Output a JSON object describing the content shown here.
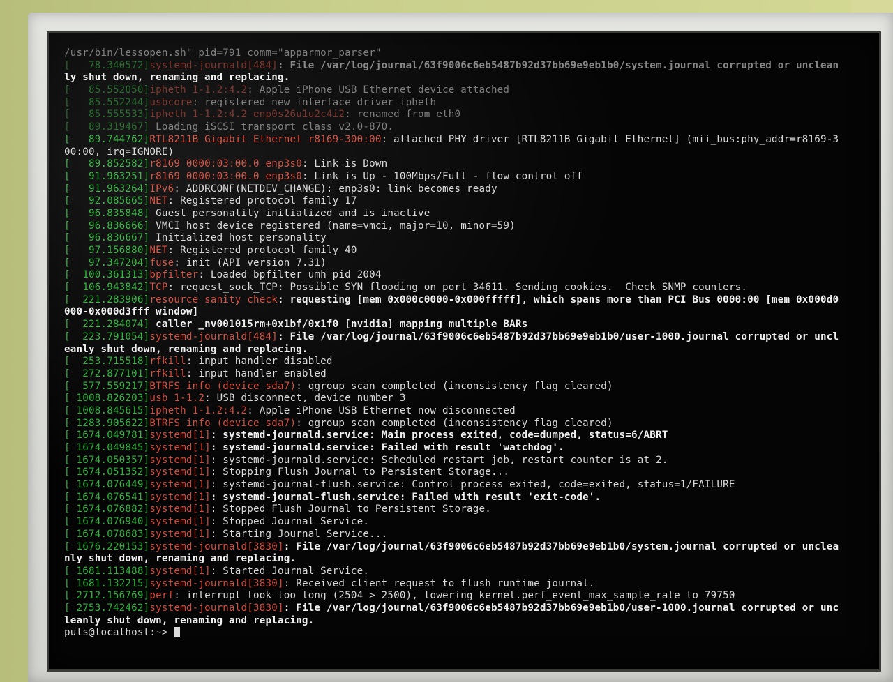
{
  "terminal": {
    "lines": [
      {
        "br": "",
        "ts": "",
        "src": "",
        "msg": "/usr/bin/lessopen.sh\" pid=791 comm=\"apparmor_parser\"",
        "dim": true
      },
      {
        "br": "[",
        "ts": "   78.340572]",
        "src": "systemd-journald[484]",
        "msg": ": File /var/log/journal/63f9006c6eb5487b92d37bb69e9eb1b0/system.journal corrupted or unclean",
        "bold": true,
        "dim": true
      },
      {
        "br": "",
        "ts": "",
        "src": "",
        "msg": "ly shut down, renaming and replacing.",
        "bold": true
      },
      {
        "br": "[",
        "ts": "   85.552050]",
        "src": "ipheth 1-1.2:4.2",
        "msg": ": Apple iPhone USB Ethernet device attached",
        "dim": true
      },
      {
        "br": "[",
        "ts": "   85.552244]",
        "src": "usbcore",
        "msg": ": registered new interface driver ipheth",
        "dim": true
      },
      {
        "br": "[",
        "ts": "   85.555533]",
        "src": "ipheth 1-1.2:4.2 enp0s26u1u2c4i2",
        "msg": ": renamed from eth0",
        "dim": true
      },
      {
        "br": "[",
        "ts": "   89.319467]",
        "src": "",
        "msg": " Loading iSCSI transport class v2.0-870.",
        "dim": true
      },
      {
        "br": "[",
        "ts": "   89.744762]",
        "src": "RTL8211B Gigabit Ethernet r8169-300:00",
        "msg": ": attached PHY driver [RTL8211B Gigabit Ethernet] (mii_bus:phy_addr=r8169-3"
      },
      {
        "br": "",
        "ts": "",
        "src": "",
        "msg": "00:00, irq=IGNORE)"
      },
      {
        "br": "[",
        "ts": "   89.852582]",
        "src": "r8169 0000:03:00.0 enp3s0",
        "msg": ": Link is Down"
      },
      {
        "br": "[",
        "ts": "   91.963251]",
        "src": "r8169 0000:03:00.0 enp3s0",
        "msg": ": Link is Up - 100Mbps/Full - flow control off"
      },
      {
        "br": "[",
        "ts": "   91.963264]",
        "src": "IPv6",
        "msg": ": ADDRCONF(NETDEV_CHANGE): enp3s0: link becomes ready"
      },
      {
        "br": "[",
        "ts": "   92.085665]",
        "src": "NET",
        "msg": ": Registered protocol family 17"
      },
      {
        "br": "[",
        "ts": "   96.835848]",
        "src": "",
        "msg": " Guest personality initialized and is inactive"
      },
      {
        "br": "[",
        "ts": "   96.836666]",
        "src": "",
        "msg": " VMCI host device registered (name=vmci, major=10, minor=59)"
      },
      {
        "br": "[",
        "ts": "   96.836667]",
        "src": "",
        "msg": " Initialized host personality"
      },
      {
        "br": "[",
        "ts": "   97.156880]",
        "src": "NET",
        "msg": ": Registered protocol family 40"
      },
      {
        "br": "[",
        "ts": "   97.347204]",
        "src": "fuse",
        "msg": ": init (API version 7.31)"
      },
      {
        "br": "[",
        "ts": "  100.361313]",
        "src": "bpfilter",
        "msg": ": Loaded bpfilter_umh pid 2004"
      },
      {
        "br": "[",
        "ts": "  106.943842]",
        "src": "TCP",
        "msg": ": request_sock_TCP: Possible SYN flooding on port 34611. Sending cookies.  Check SNMP counters."
      },
      {
        "br": "[",
        "ts": "  221.283906]",
        "src": "resource sanity check",
        "msg": ": requesting [mem 0x000c0000-0x000fffff], which spans more than PCI Bus 0000:00 [mem 0x000d0",
        "bold": true
      },
      {
        "br": "",
        "ts": "",
        "src": "",
        "msg": "000-0x000d3fff window]",
        "bold": true
      },
      {
        "br": "[",
        "ts": "  221.284074]",
        "src": "",
        "msg": " caller _nv001015rm+0x1bf/0x1f0 [nvidia] mapping multiple BARs",
        "bold": true
      },
      {
        "br": "[",
        "ts": "  223.791054]",
        "src": "systemd-journald[484]",
        "msg": ": File /var/log/journal/63f9006c6eb5487b92d37bb69e9eb1b0/user-1000.journal corrupted or uncl",
        "bold": true
      },
      {
        "br": "",
        "ts": "",
        "src": "",
        "msg": "eanly shut down, renaming and replacing.",
        "bold": true
      },
      {
        "br": "[",
        "ts": "  253.715518]",
        "src": "rfkill",
        "msg": ": input handler disabled"
      },
      {
        "br": "[",
        "ts": "  272.877101]",
        "src": "rfkill",
        "msg": ": input handler enabled"
      },
      {
        "br": "[",
        "ts": "  577.559217]",
        "src": "BTRFS info (device sda7)",
        "msg": ": qgroup scan completed (inconsistency flag cleared)"
      },
      {
        "br": "[",
        "ts": " 1008.826203]",
        "src": "usb 1-1.2",
        "msg": ": USB disconnect, device number 3"
      },
      {
        "br": "[",
        "ts": " 1008.845615]",
        "src": "ipheth 1-1.2:4.2",
        "msg": ": Apple iPhone USB Ethernet now disconnected"
      },
      {
        "br": "[",
        "ts": " 1283.905622]",
        "src": "BTRFS info (device sda7)",
        "msg": ": qgroup scan completed (inconsistency flag cleared)"
      },
      {
        "br": "[",
        "ts": " 1674.049781]",
        "src": "systemd[1]",
        "msg": ": systemd-journald.service: Main process exited, code=dumped, status=6/ABRT",
        "bold": true
      },
      {
        "br": "[",
        "ts": " 1674.049845]",
        "src": "systemd[1]",
        "msg": ": systemd-journald.service: Failed with result 'watchdog'.",
        "bold": true
      },
      {
        "br": "[",
        "ts": " 1674.050357]",
        "src": "systemd[1]",
        "msg": ": systemd-journald.service: Scheduled restart job, restart counter is at 2."
      },
      {
        "br": "[",
        "ts": " 1674.051352]",
        "src": "systemd[1]",
        "msg": ": Stopping Flush Journal to Persistent Storage..."
      },
      {
        "br": "[",
        "ts": " 1674.076449]",
        "src": "systemd[1]",
        "msg": ": systemd-journal-flush.service: Control process exited, code=exited, status=1/FAILURE"
      },
      {
        "br": "[",
        "ts": " 1674.076541]",
        "src": "systemd[1]",
        "msg": ": systemd-journal-flush.service: Failed with result 'exit-code'.",
        "bold": true
      },
      {
        "br": "[",
        "ts": " 1674.076882]",
        "src": "systemd[1]",
        "msg": ": Stopped Flush Journal to Persistent Storage."
      },
      {
        "br": "[",
        "ts": " 1674.076940]",
        "src": "systemd[1]",
        "msg": ": Stopped Journal Service."
      },
      {
        "br": "[",
        "ts": " 1674.078683]",
        "src": "systemd[1]",
        "msg": ": Starting Journal Service..."
      },
      {
        "br": "[",
        "ts": " 1676.220153]",
        "src": "systemd-journald[3830]",
        "msg": ": File /var/log/journal/63f9006c6eb5487b92d37bb69e9eb1b0/system.journal corrupted or unclea",
        "bold": true
      },
      {
        "br": "",
        "ts": "",
        "src": "",
        "msg": "nly shut down, renaming and replacing.",
        "bold": true
      },
      {
        "br": "[",
        "ts": " 1681.113488]",
        "src": "systemd[1]",
        "msg": ": Started Journal Service."
      },
      {
        "br": "[",
        "ts": " 1681.132215]",
        "src": "systemd-journald[3830]",
        "msg": ": Received client request to flush runtime journal."
      },
      {
        "br": "[",
        "ts": " 2712.156769]",
        "src": "perf",
        "msg": ": interrupt took too long (2504 > 2500), lowering kernel.perf_event_max_sample_rate to 79750"
      },
      {
        "br": "[",
        "ts": " 2753.742462]",
        "src": "systemd-journald[3830]",
        "msg": ": File /var/log/journal/63f9006c6eb5487b92d37bb69e9eb1b0/user-1000.journal corrupted or unc",
        "bold": true
      },
      {
        "br": "",
        "ts": "",
        "src": "",
        "msg": "leanly shut down, renaming and replacing.",
        "bold": true
      },
      {
        "br": "",
        "ts": "",
        "src": "",
        "msg": "puls@localhost:~>",
        "prompt": true
      }
    ]
  }
}
